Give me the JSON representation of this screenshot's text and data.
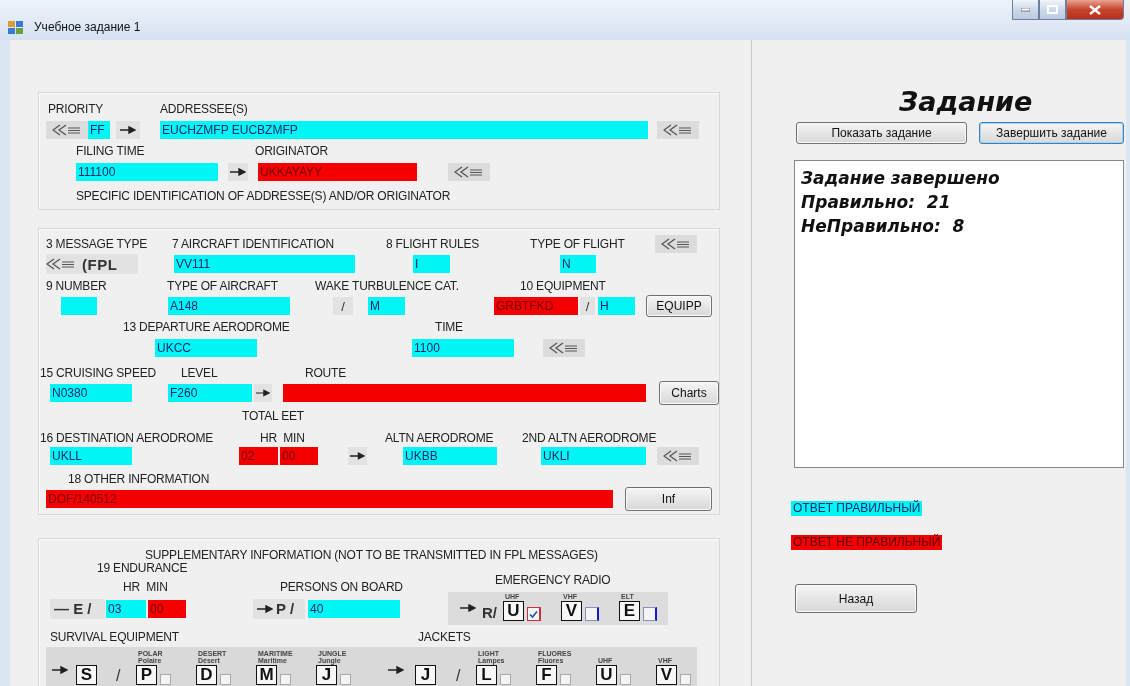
{
  "window": {
    "title": "Учебное задание 1"
  },
  "addressing": {
    "priority": {
      "label": "PRIORITY",
      "value": "FF",
      "correct": true
    },
    "addressees": {
      "label": "ADDRESSEE(S)",
      "value": "EUCHZMFP EUCBZMFP",
      "correct": true
    },
    "filing_time": {
      "label": "FILING TIME",
      "value": "111100",
      "correct": true
    },
    "originator": {
      "label": "ORIGINATOR",
      "value": "UKKAYAYY",
      "correct": false
    },
    "note": "SPECIFIC IDENTIFICATION OF ADDRESSE(S) AND/OR ORIGINATOR"
  },
  "flight_plan": {
    "message_type": {
      "label": "3 MESSAGE TYPE",
      "value": "(FPL"
    },
    "aircraft_id": {
      "label": "7 AIRCRAFT IDENTIFICATION",
      "value": "VV111",
      "correct": true
    },
    "flight_rules": {
      "label": "8 FLIGHT RULES",
      "value": "I",
      "correct": true
    },
    "flight_type": {
      "label": "TYPE OF FLIGHT",
      "value": "N",
      "correct": true
    },
    "number": {
      "label": "9 NUMBER",
      "correct": true
    },
    "aircraft_type": {
      "label": "TYPE OF AIRCRAFT",
      "value": "A148",
      "correct": true
    },
    "wake": {
      "label": "WAKE TURBULENCE CAT.",
      "separator": "/",
      "value": "M",
      "correct": true
    },
    "equipment": {
      "label": "10 EQUIPMENT",
      "value": "GRBTFKD",
      "correct": false,
      "separator": "/",
      "surveillance": {
        "value": "H",
        "correct": true
      }
    },
    "equipment_button": "EQUIPP",
    "departure": {
      "label": "13 DEPARTURE AERODROME",
      "value": "UKCC",
      "correct": true
    },
    "time": {
      "label": "TIME",
      "value": "1100",
      "correct": true
    },
    "speed": {
      "label": "15 CRUISING SPEED",
      "value": "N0380",
      "correct": true
    },
    "level": {
      "label": "LEVEL",
      "value": "F260",
      "correct": true
    },
    "route": {
      "label": "ROUTE",
      "correct": false
    },
    "charts_button": "Charts",
    "total_eet_label": "TOTAL EET",
    "destination": {
      "label": "16 DESTINATION AERODROME",
      "value": "UKLL",
      "correct": true
    },
    "eet": {
      "label": "HR  MIN",
      "hours": {
        "value": "02",
        "correct": false
      },
      "minutes": {
        "value": "00",
        "correct": false
      }
    },
    "altn": {
      "label": "ALTN AERODROME",
      "value": "UKBB",
      "correct": true
    },
    "altn2": {
      "label": "2ND ALTN AERODROME",
      "value": "UKLI",
      "correct": true
    },
    "other": {
      "label": "18 OTHER INFORMATION",
      "value": "DOF/140512",
      "correct": false
    },
    "inf_button": "Inf"
  },
  "supplementary": {
    "title": "SUPPLEMENTARY INFORMATION (NOT TO BE TRANSMITTED IN FPL MESSAGES)",
    "endurance": {
      "label": "19 ENDURANCE",
      "sublabel": "HR  MIN",
      "prefix": "— E /",
      "hours": {
        "value": "03",
        "correct": true
      },
      "minutes": {
        "value": "00",
        "correct": false
      }
    },
    "persons": {
      "label": "PERSONS ON BOARD",
      "prefix": "P /",
      "value": "40",
      "correct": true
    },
    "radio": {
      "label": "EMERGENCY RADIO",
      "prefix": "R/",
      "items": [
        {
          "caption": "UHF",
          "letter": "U",
          "checked": true
        },
        {
          "caption": "VHF",
          "letter": "V",
          "checked": false
        },
        {
          "caption": "ELT",
          "letter": "E",
          "checked": false
        }
      ]
    },
    "survival": {
      "label": "SURVIVAL EQUIPMENT",
      "letter": "S",
      "separator": "/",
      "items": [
        {
          "caption": "POLAR",
          "caption_fr": "Polaire",
          "letter": "P",
          "checked": false
        },
        {
          "caption": "DESERT",
          "caption_fr": "Désert",
          "letter": "D",
          "checked": false
        },
        {
          "caption": "MARITIME",
          "caption_fr": "Maritime",
          "letter": "M",
          "checked": false
        },
        {
          "caption": "JUNGLE",
          "caption_fr": "Jungle",
          "letter": "J",
          "checked": false
        }
      ]
    },
    "jackets": {
      "label": "JACKETS",
      "letter": "J",
      "separator": "/",
      "items": [
        {
          "caption": "LIGHT",
          "caption_fr": "Lampes",
          "letter": "L",
          "checked": false
        },
        {
          "caption": "FLUORES",
          "caption_fr": "Fluores",
          "letter": "F",
          "checked": false
        },
        {
          "caption": "UHF",
          "letter": "U",
          "checked": false
        },
        {
          "caption": "VHF",
          "letter": "V",
          "checked": false
        }
      ]
    }
  },
  "task": {
    "title": "Задание",
    "buttons": [
      {
        "label": "Показать задание",
        "focused": false
      },
      {
        "label": "Завершить задание",
        "focused": true
      }
    ],
    "result": [
      "Задание завершено",
      "Правильно:  21",
      "НеПравильно:  8"
    ]
  },
  "legend": [
    {
      "label": "ОТВЕТ ПРАВИЛЬНЫЙ",
      "correct": true
    },
    {
      "label": "ОТВЕТ НЕ ПРАВИЛЬНЫЙ",
      "correct": false
    }
  ],
  "back_button": "Назад"
}
